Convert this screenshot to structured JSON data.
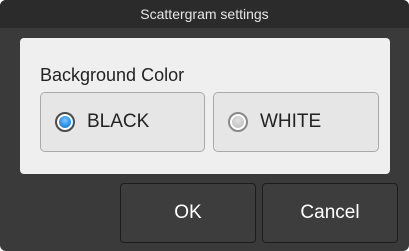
{
  "dialog": {
    "title": "Scattergram settings"
  },
  "background_color": {
    "label": "Background Color",
    "options": [
      {
        "label": "BLACK",
        "selected": true
      },
      {
        "label": "WHITE",
        "selected": false
      }
    ]
  },
  "buttons": {
    "ok_label": "OK",
    "cancel_label": "Cancel"
  },
  "colors": {
    "dialog_bg": "#3a3a3a",
    "titlebar_bg": "#2b2b2b",
    "content_bg": "#efefef",
    "selected_radio": "#2a8fe6"
  }
}
